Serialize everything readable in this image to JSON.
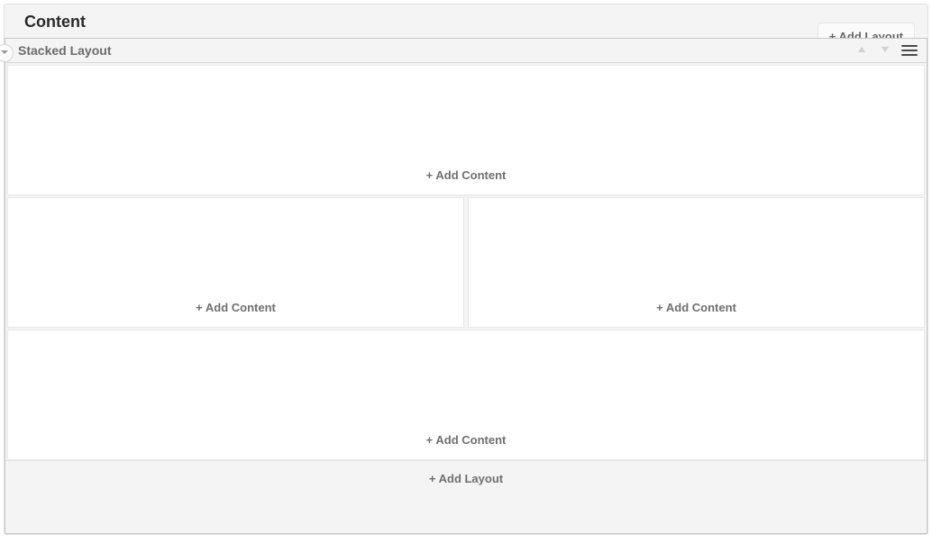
{
  "header": {
    "title": "Content",
    "add_layout_label": "+ Add Layout"
  },
  "layout": {
    "title": "Stacked Layout",
    "rows": [
      {
        "type": "full",
        "cells": [
          {
            "add_label": "+ Add Content"
          }
        ]
      },
      {
        "type": "split",
        "cells": [
          {
            "add_label": "+ Add Content"
          },
          {
            "add_label": "+ Add Content"
          }
        ]
      },
      {
        "type": "full",
        "cells": [
          {
            "add_label": "+ Add Content"
          }
        ]
      }
    ],
    "footer_add_layout_label": "+ Add Layout"
  }
}
